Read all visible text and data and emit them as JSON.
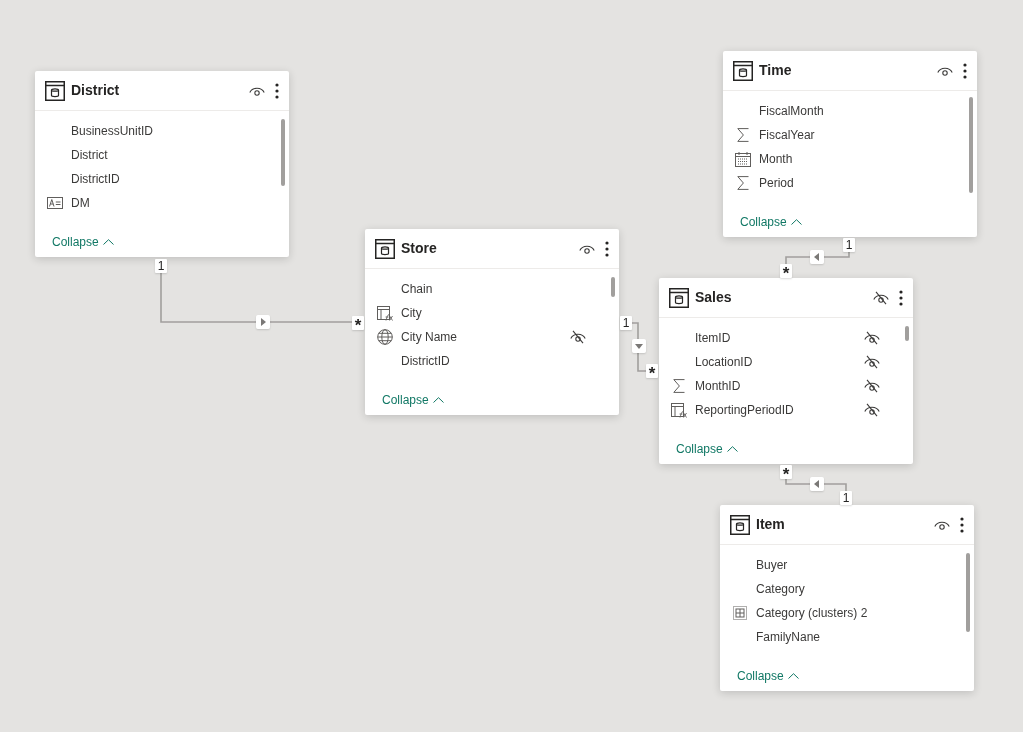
{
  "tables": [
    {
      "name": "District",
      "hidden": false,
      "fields": [
        {
          "name": "BusinessUnitID",
          "kind": "plain",
          "hidden": false
        },
        {
          "name": "District",
          "kind": "plain",
          "hidden": false
        },
        {
          "name": "DistrictID",
          "kind": "plain",
          "hidden": false
        },
        {
          "name": "DM",
          "kind": "text",
          "hidden": false
        }
      ],
      "collapse_label": "Collapse"
    },
    {
      "name": "Store",
      "hidden": false,
      "fields": [
        {
          "name": "Chain",
          "kind": "plain",
          "hidden": false
        },
        {
          "name": "City",
          "kind": "calculated",
          "hidden": false
        },
        {
          "name": "City Name",
          "kind": "geo",
          "hidden": true
        },
        {
          "name": "DistrictID",
          "kind": "plain",
          "hidden": false
        }
      ],
      "collapse_label": "Collapse"
    },
    {
      "name": "Time",
      "hidden": false,
      "fields": [
        {
          "name": "FiscalMonth",
          "kind": "plain",
          "hidden": false
        },
        {
          "name": "FiscalYear",
          "kind": "sum",
          "hidden": false
        },
        {
          "name": "Month",
          "kind": "date",
          "hidden": false
        },
        {
          "name": "Period",
          "kind": "sum",
          "hidden": false
        }
      ],
      "collapse_label": "Collapse"
    },
    {
      "name": "Sales",
      "hidden": true,
      "fields": [
        {
          "name": "ItemID",
          "kind": "plain",
          "hidden": true
        },
        {
          "name": "LocationID",
          "kind": "plain",
          "hidden": true
        },
        {
          "name": "MonthID",
          "kind": "sum",
          "hidden": true
        },
        {
          "name": "ReportingPeriodID",
          "kind": "calculated",
          "hidden": true
        }
      ],
      "collapse_label": "Collapse"
    },
    {
      "name": "Item",
      "hidden": false,
      "fields": [
        {
          "name": "Buyer",
          "kind": "plain",
          "hidden": false
        },
        {
          "name": "Category",
          "kind": "plain",
          "hidden": false
        },
        {
          "name": "Category (clusters) 2",
          "kind": "group",
          "hidden": false
        },
        {
          "name": "FamilyNane",
          "kind": "plain",
          "hidden": false
        }
      ],
      "collapse_label": "Collapse"
    }
  ],
  "relationships": [
    {
      "one_label": "1",
      "many_label": "*",
      "kind": "right"
    },
    {
      "one_label": "1",
      "many_label": "*",
      "kind": "down"
    },
    {
      "one_label": "1",
      "many_label": "*",
      "kind": "left"
    },
    {
      "one_label": "1",
      "many_label": "*",
      "kind": "left"
    }
  ]
}
